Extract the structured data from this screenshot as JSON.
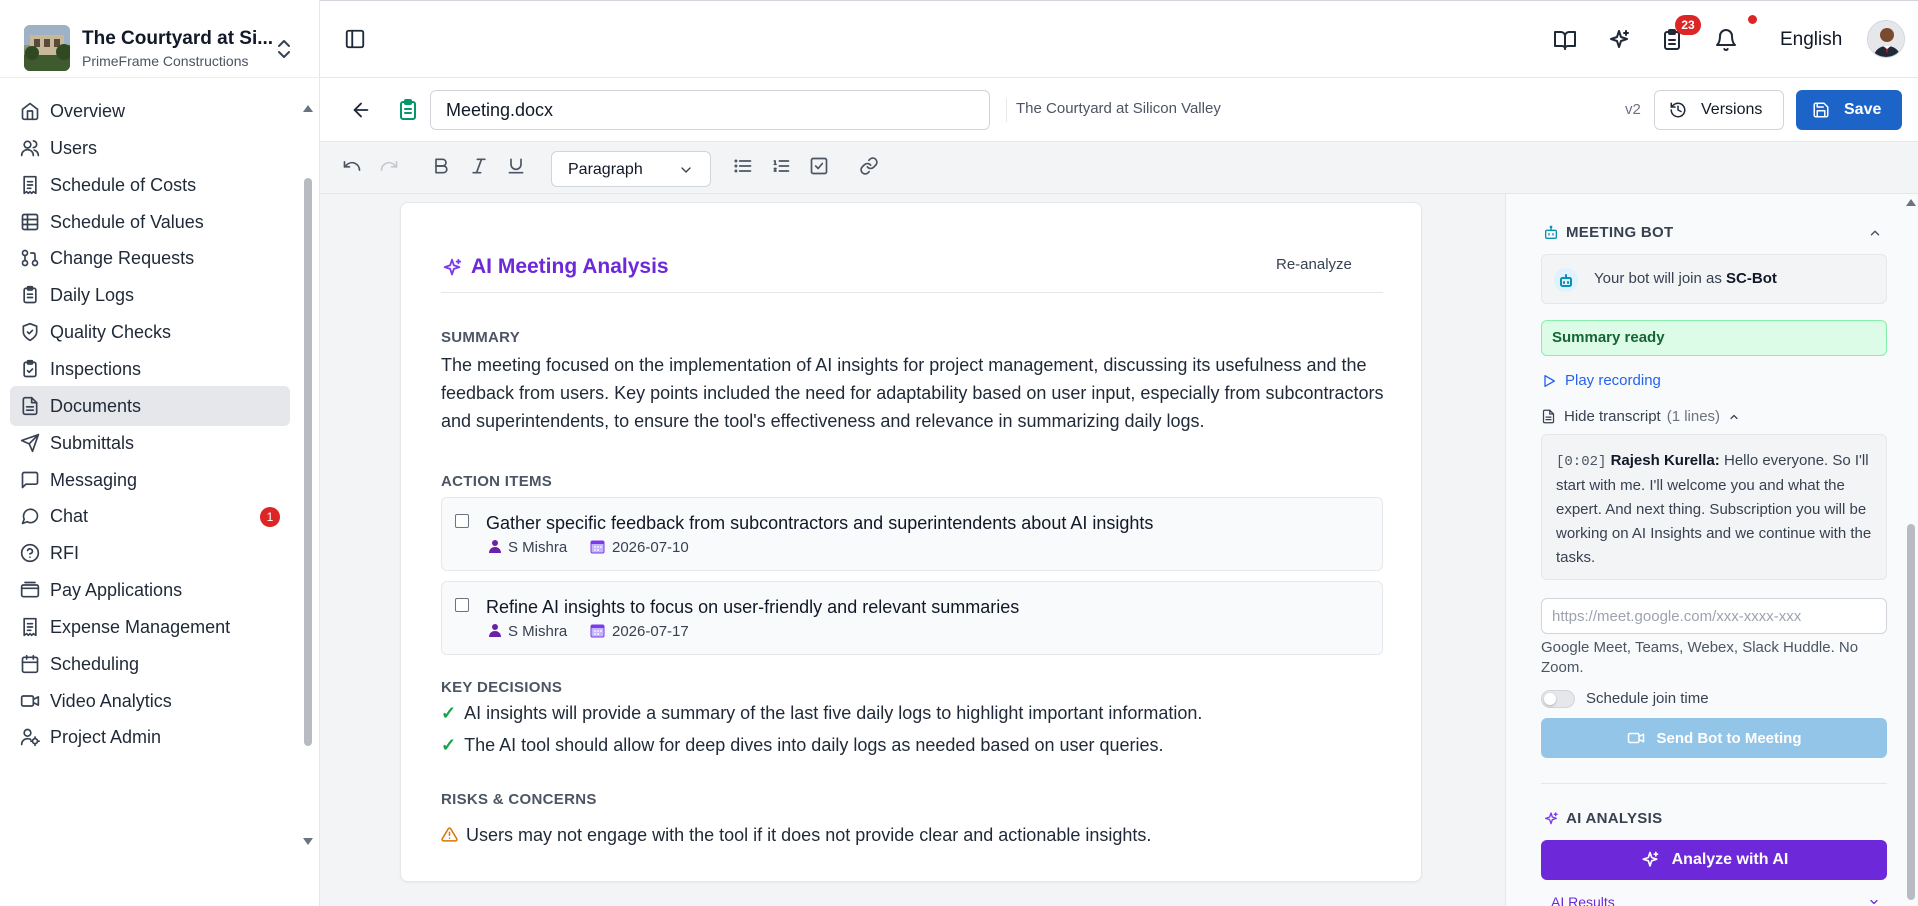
{
  "project": {
    "title": "The Courtyard at Si...",
    "company": "PrimeFrame Constructions"
  },
  "nav": [
    {
      "label": "Overview",
      "icon": "home-icon"
    },
    {
      "label": "Users",
      "icon": "users-icon"
    },
    {
      "label": "Schedule of Costs",
      "icon": "receipt-icon"
    },
    {
      "label": "Schedule of Values",
      "icon": "table-icon"
    },
    {
      "label": "Change Requests",
      "icon": "git-pull-request-icon"
    },
    {
      "label": "Daily Logs",
      "icon": "clipboard-icon"
    },
    {
      "label": "Quality Checks",
      "icon": "shield-check-icon"
    },
    {
      "label": "Inspections",
      "icon": "clipboard-check-icon"
    },
    {
      "label": "Documents",
      "icon": "file-text-icon",
      "active": true
    },
    {
      "label": "Submittals",
      "icon": "send-icon"
    },
    {
      "label": "Messaging",
      "icon": "message-square-icon"
    },
    {
      "label": "Chat",
      "icon": "message-circle-icon",
      "badge": "1"
    },
    {
      "label": "RFI",
      "icon": "help-circle-icon"
    },
    {
      "label": "Pay Applications",
      "icon": "wallet-icon"
    },
    {
      "label": "Expense Management",
      "icon": "receipt-icon"
    },
    {
      "label": "Scheduling",
      "icon": "calendar-icon"
    },
    {
      "label": "Video Analytics",
      "icon": "video-icon"
    },
    {
      "label": "Project Admin",
      "icon": "user-cog-icon"
    }
  ],
  "topbar": {
    "tasks_badge": "23",
    "language": "English"
  },
  "document": {
    "name": "Meeting.docx",
    "project": "The Courtyard at Silicon Valley",
    "version": "v2",
    "versions_label": "Versions",
    "save_label": "Save"
  },
  "toolbar": {
    "block_type": "Paragraph"
  },
  "analysis": {
    "title": "AI Meeting Analysis",
    "reanalyze_label": "Re-analyze",
    "summary_heading": "SUMMARY",
    "summary": "The meeting focused on the implementation of AI insights for project management, discussing its usefulness and the feedback from users. Key points included the need for adaptability based on user input, especially from subcontractors and superintendents, to ensure the tool's effectiveness and relevance in summarizing daily logs.",
    "action_heading": "ACTION ITEMS",
    "actions": [
      {
        "text": "Gather specific feedback from subcontractors and superintendents about AI insights",
        "assignee": "S Mishra",
        "date": "2026-07-10"
      },
      {
        "text": "Refine AI insights to focus on user-friendly and relevant summaries",
        "assignee": "S Mishra",
        "date": "2026-07-17"
      }
    ],
    "decisions_heading": "KEY DECISIONS",
    "decisions": [
      "AI insights will provide a summary of the last five daily logs to highlight important information.",
      "The AI tool should allow for deep dives into daily logs as needed based on user queries."
    ],
    "risks_heading": "RISKS & CONCERNS",
    "risks": [
      "Users may not engage with the tool if it does not provide clear and actionable insights."
    ]
  },
  "meeting_bot": {
    "heading": "MEETING BOT",
    "join_prefix": "Your bot will join as",
    "bot_name": "SC-Bot",
    "status": "Summary ready",
    "play_label": "Play recording",
    "hide_transcript_label": "Hide transcript",
    "transcript_count": "(1 lines)",
    "transcript": {
      "timestamp": "[0:02]",
      "speaker": "Rajesh Kurella:",
      "text": "Hello everyone. So I'll start with me. I'll welcome you and what the expert. And next thing. Subscription you will be working on AI Insights and we continue with the tasks."
    },
    "url_placeholder": "https://meet.google.com/xxx-xxxx-xxx",
    "platforms_note": "Google Meet, Teams, Webex, Slack Huddle. No Zoom.",
    "schedule_label": "Schedule join time",
    "send_label": "Send Bot to Meeting"
  },
  "ai_analysis": {
    "heading": "AI ANALYSIS",
    "analyze_label": "Analyze with AI",
    "results_label": "AI Results"
  },
  "colors": {
    "primary": "#1d64c8",
    "ai_purple": "#6d28d9",
    "success_bg": "#dcfce7",
    "badge_red": "#dc2626"
  }
}
